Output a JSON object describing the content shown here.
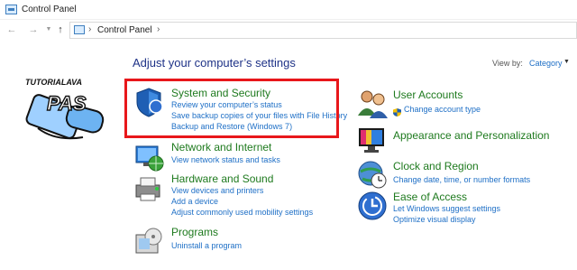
{
  "window": {
    "title": "Control Panel"
  },
  "address": {
    "crumb": "Control Panel"
  },
  "header": {
    "heading": "Adjust your computer’s settings",
    "view_by_label": "View by:",
    "view_by_value": "Category"
  },
  "logo": {
    "top_text": "TUTORIALAVA",
    "big_text": "PAS"
  },
  "categories": {
    "system": {
      "title": "System and Security",
      "links": [
        "Review your computer’s status",
        "Save backup copies of your files with File History",
        "Backup and Restore (Windows 7)"
      ]
    },
    "network": {
      "title": "Network and Internet",
      "links": [
        "View network status and tasks"
      ]
    },
    "hardware": {
      "title": "Hardware and Sound",
      "links": [
        "View devices and printers",
        "Add a device",
        "Adjust commonly used mobility settings"
      ]
    },
    "programs": {
      "title": "Programs",
      "links": [
        "Uninstall a program"
      ]
    },
    "user": {
      "title": "User Accounts",
      "links": [
        "Change account type"
      ]
    },
    "appearance": {
      "title": "Appearance and Personalization",
      "links": []
    },
    "clock": {
      "title": "Clock and Region",
      "links": [
        "Change date, time, or number formats"
      ]
    },
    "ease": {
      "title": "Ease of Access",
      "links": [
        "Let Windows suggest settings",
        "Optimize visual display"
      ]
    }
  },
  "colors": {
    "category_title": "#1e7a1e",
    "link": "#1e6fc6",
    "heading": "#1e3287",
    "highlight": "#e8171b"
  }
}
